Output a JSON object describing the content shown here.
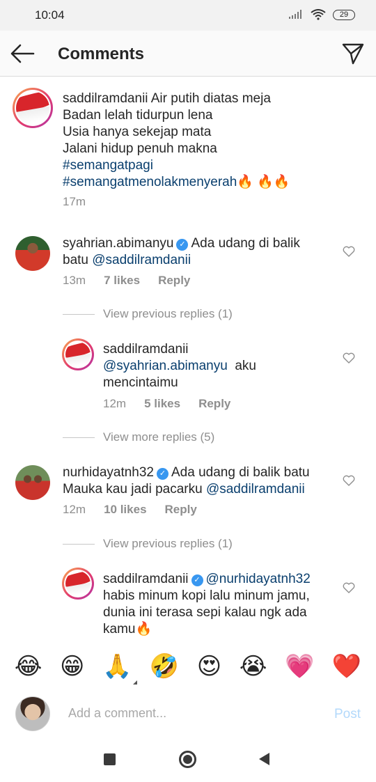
{
  "status_bar": {
    "time": "10:04",
    "battery": "29"
  },
  "header": {
    "title": "Comments"
  },
  "caption": {
    "username": "saddilramdanii",
    "line1": "Air putih diatas meja",
    "line2": "Badan lelah tidurpun lena",
    "line3": "Usia hanya sekejap mata",
    "line4": "Jalani hidup penuh makna",
    "tag1": "#semangatpagi",
    "tag2": "#semangatmenolakmenyerah",
    "tag2_emoji": "🔥 🔥🔥",
    "time": "17m"
  },
  "comments": [
    {
      "username": "syahrian.abimanyu",
      "text1": "Ada udang di balik",
      "text2": "batu",
      "mention": "@saddilramdanii",
      "time": "13m",
      "likes": "7 likes",
      "reply": "Reply",
      "view_replies": "View previous replies (1)",
      "replies": [
        {
          "username": "saddilramdanii",
          "mention": "@syahrian.abimanyu",
          "text1": "aku",
          "text2": "mencintaimu",
          "time": "12m",
          "likes": "5 likes",
          "reply": "Reply"
        }
      ],
      "view_more": "View more replies (5)"
    },
    {
      "username": "nurhidayatnh32",
      "text1": "Ada udang di balik batu",
      "text2": "Mauka kau jadi pacarku",
      "mention": "@saddilramdanii",
      "time": "12m",
      "likes": "10 likes",
      "reply": "Reply",
      "view_replies": "View previous replies (1)",
      "replies": [
        {
          "username": "saddilramdanii",
          "mention": "@nurhidayatnh32",
          "text1": "habis minum kopi lalu minum jamu,",
          "text2": "dunia ini terasa sepi kalau ngk ada",
          "text3": "kamu",
          "emoji": "🔥"
        }
      ]
    }
  ],
  "emoji_bar": [
    "😂",
    "😁",
    "🙏",
    "🤣",
    "😍",
    "😭",
    "💗",
    "❤️"
  ],
  "add_comment": {
    "placeholder": "Add a comment...",
    "post": "Post"
  },
  "colors": {
    "link": "#0a3f6e",
    "verified": "#3897f0",
    "muted": "#8e8e8e",
    "post": "#b3d9fb"
  }
}
